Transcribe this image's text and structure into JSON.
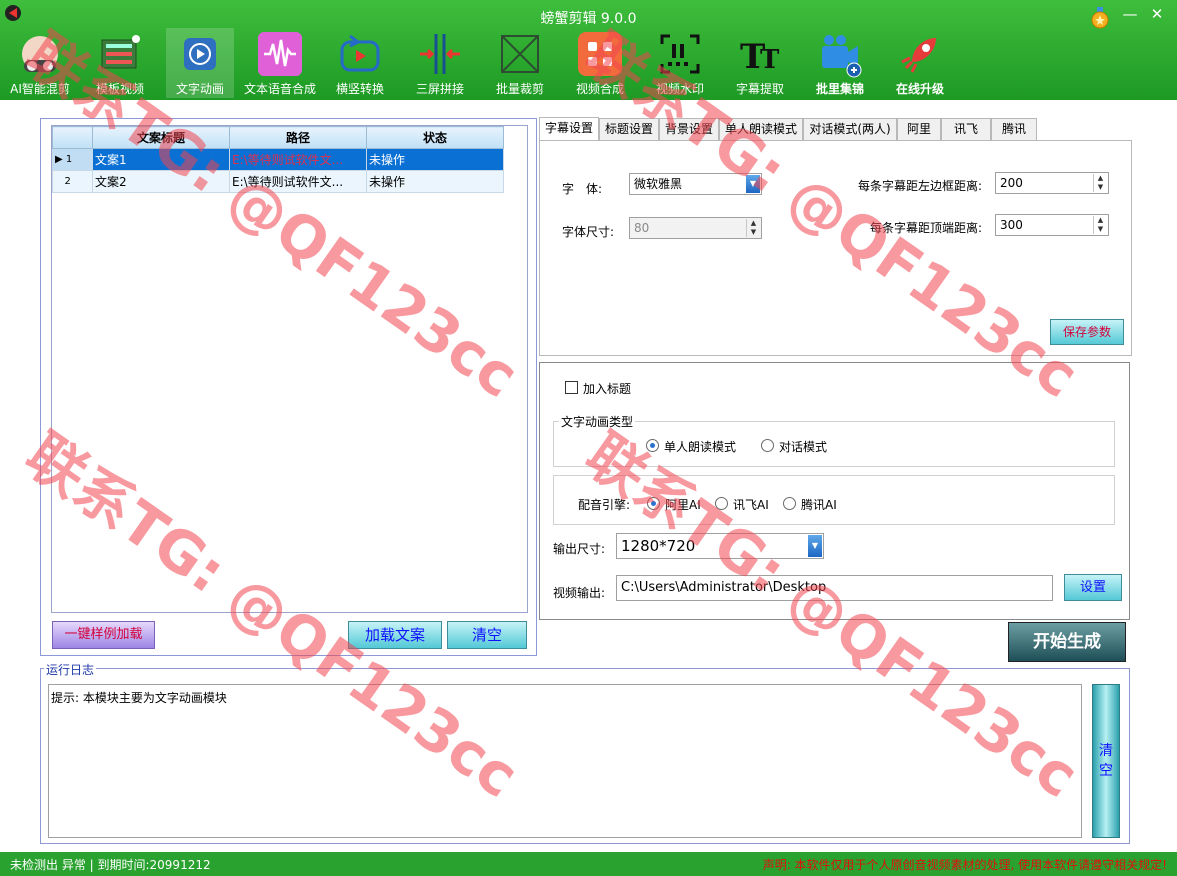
{
  "app": {
    "title": "螃蟹剪辑 9.0.0",
    "minimize": "—",
    "close": "✕"
  },
  "toolbar": [
    {
      "label": "AI智能混剪",
      "icon": "ai-mix-icon"
    },
    {
      "label": "模板视频",
      "icon": "template-video-icon"
    },
    {
      "label": "文字动画",
      "icon": "text-animation-icon",
      "active": true
    },
    {
      "label": "文本语音合成",
      "icon": "tts-icon"
    },
    {
      "label": "横竖转换",
      "icon": "rotate-icon"
    },
    {
      "label": "三屏拼接",
      "icon": "three-screen-icon"
    },
    {
      "label": "批量裁剪",
      "icon": "crop-icon"
    },
    {
      "label": "视频合成",
      "icon": "video-merge-icon"
    },
    {
      "label": "视频水印",
      "icon": "watermark-icon"
    },
    {
      "label": "字幕提取",
      "icon": "subtitle-extract-icon"
    },
    {
      "label": "批里集锦",
      "icon": "batch-highlight-icon"
    },
    {
      "label": "在线升级",
      "icon": "rocket-icon"
    }
  ],
  "grid": {
    "columns": [
      "文案标题",
      "路径",
      "状态"
    ],
    "rows": [
      {
        "no": "1",
        "title": "文案1",
        "path": "E:\\等待则试软件文...",
        "status": "未操作"
      },
      {
        "no": "2",
        "title": "文案2",
        "path": "E:\\等待则试软件文...",
        "status": "未操作"
      }
    ]
  },
  "left_buttons": {
    "load_sample": "一键样例加载",
    "load": "加载文案",
    "clear": "清空"
  },
  "tabs": [
    "字幕设置",
    "标题设置",
    "背景设置",
    "单人朗读模式",
    "对话模式(两人)",
    "阿里",
    "讯飞",
    "腾讯"
  ],
  "subtitle": {
    "font_label": "字　体:",
    "font_value": "微软雅黑",
    "size_label": "字体尺寸:",
    "size_value": "80",
    "left_label": "每条字幕距左边框距离:",
    "left_value": "200",
    "top_label": "每条字幕距顶端距离:",
    "top_value": "300",
    "save": "保存参数"
  },
  "anim": {
    "add_title": "加入标题",
    "type_title": "文字动画类型",
    "type_options": [
      "单人朗读模式",
      "对话模式"
    ],
    "engine_label": "配音引擎:",
    "engine_options": [
      "阿里AI",
      "讯飞AI",
      "腾讯AI"
    ],
    "output_size_label": "输出尺寸:",
    "output_size": "1280*720",
    "video_out_label": "视频输出:",
    "video_out_path": "C:\\Users\\Administrator\\Desktop",
    "set": "设置"
  },
  "start": "开始生成",
  "log": {
    "title": "运行日志",
    "text": "提示: 本模块主要为文字动画模块",
    "clear": "清空"
  },
  "status": {
    "left": "未检测出 异常 | 到期时间:20991212",
    "right": "声明: 本软件仅用于个人原创音视频素材的处理, 使用本软件请遵守相关规定!"
  },
  "watermark": "联系TG: @QF123cc",
  "colors": {
    "toolbar": "#2fae32",
    "accent_blue": "#0a70d4",
    "button_text": "#1010ff",
    "watermark": "#f04650"
  }
}
